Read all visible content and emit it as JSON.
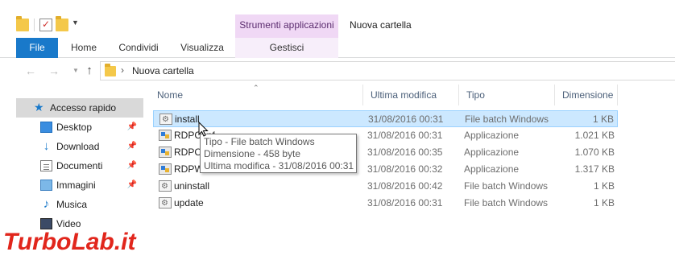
{
  "titlebar": {
    "context_tab_label": "Strumenti applicazioni",
    "window_title": "Nuova cartella",
    "icons": [
      "folder-icon",
      "properties-icon",
      "new-folder-icon",
      "customize-qat-icon"
    ]
  },
  "ribbon": {
    "tabs": [
      {
        "label": "File"
      },
      {
        "label": "Home"
      },
      {
        "label": "Condividi"
      },
      {
        "label": "Visualizza"
      },
      {
        "label": "Gestisci"
      }
    ],
    "accent_color": "#1979ca",
    "context_color": "#f0d8f5"
  },
  "address_bar": {
    "path": "Nuova cartella",
    "nav_icons": [
      "back-arrow-icon",
      "forward-arrow-icon",
      "recent-dropdown-icon",
      "up-arrow-icon"
    ]
  },
  "nav_pane": {
    "quick_access": "Accesso rapido",
    "items": [
      {
        "label": "Desktop",
        "icon": "desktop-icon",
        "pinned": true
      },
      {
        "label": "Download",
        "icon": "download-icon",
        "pinned": true
      },
      {
        "label": "Documenti",
        "icon": "documents-icon",
        "pinned": true
      },
      {
        "label": "Immagini",
        "icon": "pictures-icon",
        "pinned": true
      },
      {
        "label": "Musica",
        "icon": "music-icon",
        "pinned": false
      },
      {
        "label": "Video",
        "icon": "video-icon",
        "pinned": false
      }
    ]
  },
  "file_list": {
    "columns": {
      "name": "Nome",
      "date": "Ultima modifica",
      "type": "Tipo",
      "size": "Dimensione"
    },
    "rows": [
      {
        "name": "install",
        "date": "31/08/2016 00:31",
        "type": "File batch Windows",
        "size": "1 KB",
        "icon": "batch-file-icon",
        "selected": true
      },
      {
        "name": "RDPConf",
        "date": "31/08/2016 00:31",
        "type": "Applicazione",
        "size": "1.021 KB",
        "icon": "application-icon",
        "selected": false
      },
      {
        "name": "RDPCheck",
        "date": "31/08/2016 00:35",
        "type": "Applicazione",
        "size": "1.070 KB",
        "icon": "application-icon",
        "selected": false
      },
      {
        "name": "RDPWInst",
        "date": "31/08/2016 00:32",
        "type": "Applicazione",
        "size": "1.317 KB",
        "icon": "application-icon",
        "selected": false
      },
      {
        "name": "uninstall",
        "date": "31/08/2016 00:42",
        "type": "File batch Windows",
        "size": "1 KB",
        "icon": "batch-file-icon",
        "selected": false
      },
      {
        "name": "update",
        "date": "31/08/2016 00:31",
        "type": "File batch Windows",
        "size": "1 KB",
        "icon": "batch-file-icon",
        "selected": false
      }
    ]
  },
  "tooltip": {
    "line1": "Tipo - File batch Windows",
    "line2": "Dimensione - 458 byte",
    "line3": "Ultima modifica - 31/08/2016 00:31"
  },
  "watermark": {
    "text_part1": "Turbo",
    "text_part2": "Lab.it"
  }
}
